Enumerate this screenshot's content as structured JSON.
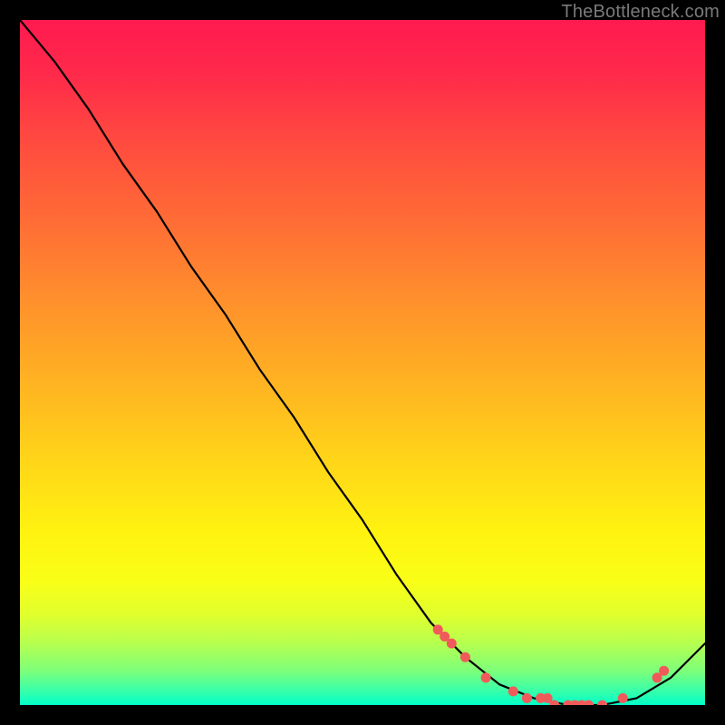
{
  "watermark": "TheBottleneck.com",
  "chart_data": {
    "type": "line",
    "x": [
      0.0,
      0.05,
      0.1,
      0.15,
      0.2,
      0.25,
      0.3,
      0.35,
      0.4,
      0.45,
      0.5,
      0.55,
      0.6,
      0.65,
      0.7,
      0.75,
      0.8,
      0.85,
      0.9,
      0.95,
      1.0
    ],
    "values": [
      1.0,
      0.94,
      0.87,
      0.79,
      0.72,
      0.64,
      0.57,
      0.49,
      0.42,
      0.34,
      0.27,
      0.19,
      0.12,
      0.07,
      0.03,
      0.01,
      0.0,
      0.0,
      0.01,
      0.04,
      0.09
    ],
    "xlim": [
      0,
      1
    ],
    "ylim": [
      0,
      1
    ],
    "xlabel": "",
    "ylabel": "",
    "title": "",
    "marker_points": {
      "x": [
        0.61,
        0.62,
        0.63,
        0.65,
        0.68,
        0.72,
        0.74,
        0.76,
        0.77,
        0.78,
        0.8,
        0.81,
        0.82,
        0.83,
        0.85,
        0.88,
        0.93,
        0.94
      ],
      "y": [
        0.11,
        0.1,
        0.09,
        0.07,
        0.04,
        0.02,
        0.01,
        0.01,
        0.01,
        0.0,
        0.0,
        0.0,
        0.0,
        0.0,
        0.0,
        0.01,
        0.04,
        0.05
      ]
    }
  },
  "colors": {
    "marker": "#f15a5a",
    "curve": "#000000"
  }
}
